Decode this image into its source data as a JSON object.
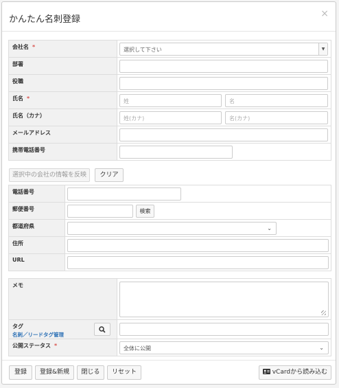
{
  "dialog": {
    "title": "かんたん名刺登録",
    "close": "×"
  },
  "fields": {
    "company": {
      "label": "会社名",
      "required": "*",
      "placeholder": "選択して下さい"
    },
    "department": {
      "label": "部署"
    },
    "position": {
      "label": "役職"
    },
    "name": {
      "label": "氏名",
      "required": "*",
      "last_placeholder": "姓",
      "first_placeholder": "名"
    },
    "name_kana": {
      "label": "氏名（カナ）",
      "last_placeholder": "姓(カナ)",
      "first_placeholder": "名(カナ)"
    },
    "email": {
      "label": "メールアドレス"
    },
    "mobile": {
      "label": "携帯電話番号"
    }
  },
  "company_actions": {
    "reflect_label": "選択中の会社の情報を反映",
    "clear_label": "クリア"
  },
  "company_fields": {
    "phone": {
      "label": "電話番号"
    },
    "postal": {
      "label": "郵便番号",
      "search_label": "検索"
    },
    "prefecture": {
      "label": "都道府県"
    },
    "address": {
      "label": "住所"
    },
    "url": {
      "label": "URL"
    }
  },
  "extra": {
    "memo": {
      "label": "メモ"
    },
    "tag": {
      "label": "タグ",
      "link": "名刺／リードタグ管理"
    },
    "visibility": {
      "label": "公開ステータス",
      "required": "*",
      "value": "全体に公開"
    }
  },
  "footer": {
    "register": "登録",
    "register_new": "登録&新規",
    "close": "閉じる",
    "reset": "リセット",
    "vcard": "vCardから読み込む"
  },
  "icons": {
    "search": "search-icon",
    "vcard": "contact-card-icon",
    "grip": "resize-grip-icon"
  }
}
